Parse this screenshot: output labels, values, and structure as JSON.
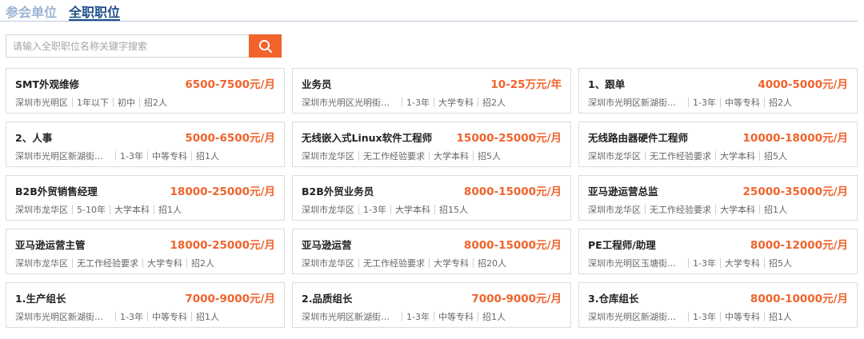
{
  "tabs": [
    {
      "label": "参会单位",
      "active": false
    },
    {
      "label": "全职职位",
      "active": true
    }
  ],
  "search": {
    "placeholder": "请输入全职职位名称关键字搜索",
    "value": "",
    "icon": "search-icon"
  },
  "colors": {
    "accent": "#f2622b",
    "salary": "#f0632c",
    "active_tab": "#1f4e88",
    "inactive_tab": "#9bb4d2"
  },
  "jobs": [
    {
      "title": "SMT外观维修",
      "salary": "6500-7500元/月",
      "location": "深圳市光明区",
      "experience": "1年以下",
      "education": "初中",
      "headcount": "招2人"
    },
    {
      "title": "业务员",
      "salary": "10-25万元/年",
      "location": "深圳市光明区光明街道...",
      "experience": "1-3年",
      "education": "大学专科",
      "headcount": "招2人"
    },
    {
      "title": "1、跟单",
      "salary": "4000-5000元/月",
      "location": "深圳市光明区新湖街道...",
      "experience": "1-3年",
      "education": "中等专科",
      "headcount": "招2人"
    },
    {
      "title": "2、人事",
      "salary": "5000-6500元/月",
      "location": "深圳市光明区新湖街道...",
      "experience": "1-3年",
      "education": "中等专科",
      "headcount": "招1人"
    },
    {
      "title": "无线嵌入式Linux软件工程师",
      "salary": "15000-25000元/月",
      "location": "深圳市龙华区",
      "experience": "无工作经验要求",
      "education": "大学本科",
      "headcount": "招5人"
    },
    {
      "title": "无线路由器硬件工程师",
      "salary": "10000-18000元/月",
      "location": "深圳市龙华区",
      "experience": "无工作经验要求",
      "education": "大学本科",
      "headcount": "招5人"
    },
    {
      "title": "B2B外贸销售经理",
      "salary": "18000-25000元/月",
      "location": "深圳市龙华区",
      "experience": "5-10年",
      "education": "大学本科",
      "headcount": "招1人"
    },
    {
      "title": "B2B外贸业务员",
      "salary": "8000-15000元/月",
      "location": "深圳市龙华区",
      "experience": "1-3年",
      "education": "大学本科",
      "headcount": "招15人"
    },
    {
      "title": "亚马逊运营总监",
      "salary": "25000-35000元/月",
      "location": "深圳市龙华区",
      "experience": "无工作经验要求",
      "education": "大学本科",
      "headcount": "招1人"
    },
    {
      "title": "亚马逊运营主管",
      "salary": "18000-25000元/月",
      "location": "深圳市龙华区",
      "experience": "无工作经验要求",
      "education": "大学专科",
      "headcount": "招2人"
    },
    {
      "title": "亚马逊运营",
      "salary": "8000-15000元/月",
      "location": "深圳市龙华区",
      "experience": "无工作经验要求",
      "education": "大学专科",
      "headcount": "招20人"
    },
    {
      "title": "PE工程师/助理",
      "salary": "8000-12000元/月",
      "location": "深圳市光明区玉塘街道...",
      "experience": "1-3年",
      "education": "大学专科",
      "headcount": "招5人"
    },
    {
      "title": "1.生产组长",
      "salary": "7000-9000元/月",
      "location": "深圳市光明区新湖街道...",
      "experience": "1-3年",
      "education": "中等专科",
      "headcount": "招1人"
    },
    {
      "title": "2.品质组长",
      "salary": "7000-9000元/月",
      "location": "深圳市光明区新湖街道...",
      "experience": "1-3年",
      "education": "中等专科",
      "headcount": "招1人"
    },
    {
      "title": "3.仓库组长",
      "salary": "8000-10000元/月",
      "location": "深圳市光明区新湖街道...",
      "experience": "1-3年",
      "education": "中等专科",
      "headcount": "招1人"
    }
  ]
}
